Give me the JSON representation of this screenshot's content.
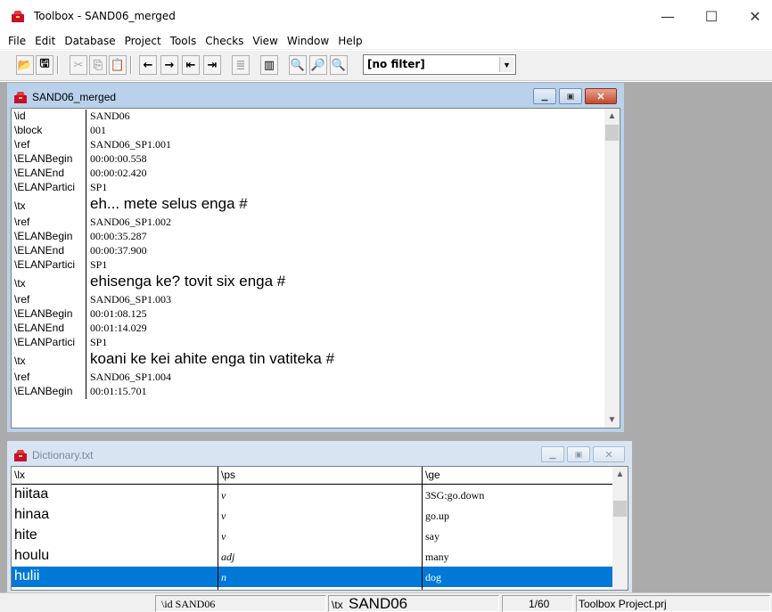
{
  "app": {
    "title": "Toolbox - SAND06_merged",
    "min_glyph": "—",
    "max_glyph": "☐",
    "close_glyph": "✕"
  },
  "menu": [
    "File",
    "Edit",
    "Database",
    "Project",
    "Tools",
    "Checks",
    "View",
    "Window",
    "Help"
  ],
  "toolbar": {
    "buttons": [
      {
        "icon": "open-folder-icon",
        "glyph": "📂"
      },
      {
        "icon": "save-icon",
        "glyph": "🖫"
      },
      {
        "icon": "cut-icon",
        "glyph": "✂"
      },
      {
        "icon": "copy-icon",
        "glyph": "⎘"
      },
      {
        "icon": "paste-icon",
        "glyph": "📋"
      },
      {
        "icon": "arrow-left-icon",
        "glyph": "←"
      },
      {
        "icon": "arrow-right-icon",
        "glyph": "→"
      },
      {
        "icon": "first-record-icon",
        "glyph": "⇤"
      },
      {
        "icon": "last-record-icon",
        "glyph": "⇥"
      },
      {
        "icon": "interlinear-icon",
        "glyph": "≣"
      },
      {
        "icon": "browse-icon",
        "glyph": "▥"
      },
      {
        "icon": "find-icon",
        "glyph": "🔍"
      },
      {
        "icon": "find-next-icon",
        "glyph": "🔎"
      },
      {
        "icon": "find-prev-icon",
        "glyph": "🔍"
      }
    ],
    "filter_value": "[no filter]"
  },
  "record_window": {
    "title": "SAND06_merged",
    "rows": [
      {
        "marker": "\\id",
        "value": "SAND06"
      },
      {
        "marker": "\\block",
        "value": "001"
      },
      {
        "marker": "\\ref",
        "value": "SAND06_SP1.001"
      },
      {
        "marker": "\\ELANBegin",
        "value": "00:00:00.558"
      },
      {
        "marker": "\\ELANEnd",
        "value": "00:00:02.420"
      },
      {
        "marker": "\\ELANPartici",
        "value": "SP1"
      },
      {
        "marker": "\\tx",
        "value": "eh... mete selus enga #",
        "big": true
      },
      {
        "marker": "\\ref",
        "value": "SAND06_SP1.002"
      },
      {
        "marker": "\\ELANBegin",
        "value": "00:00:35.287"
      },
      {
        "marker": "\\ELANEnd",
        "value": "00:00:37.900"
      },
      {
        "marker": "\\ELANPartici",
        "value": "SP1"
      },
      {
        "marker": "\\tx",
        "value": "ehisenga ke? tovit six enga #",
        "big": true
      },
      {
        "marker": "\\ref",
        "value": "SAND06_SP1.003"
      },
      {
        "marker": "\\ELANBegin",
        "value": "00:01:08.125"
      },
      {
        "marker": "\\ELANEnd",
        "value": "00:01:14.029"
      },
      {
        "marker": "\\ELANPartici",
        "value": "SP1"
      },
      {
        "marker": "\\tx",
        "value": "koani ke kei ahite enga tin vatiteka #",
        "big": true
      },
      {
        "marker": "\\ref",
        "value": "SAND06_SP1.004"
      },
      {
        "marker": "\\ELANBegin",
        "value": "00:01:15.701"
      }
    ]
  },
  "dictionary_window": {
    "title": "Dictionary.txt",
    "headers": [
      "\\lx",
      "\\ps",
      "\\ge"
    ],
    "rows": [
      {
        "lx": "hiitaa",
        "ps": "v",
        "ge": "3SG:go.down"
      },
      {
        "lx": "hinaa",
        "ps": "v",
        "ge": "go.up"
      },
      {
        "lx": "hite",
        "ps": "v",
        "ge": "say"
      },
      {
        "lx": "houlu",
        "ps": "adj",
        "ge": "many"
      },
      {
        "lx": "hulii",
        "ps": "n",
        "ge": "dog",
        "selected": true
      }
    ]
  },
  "statusbar": {
    "record_id": "\\id  SAND06",
    "tx_marker": "\\tx",
    "tx_value": "SAND06",
    "position": "1/60",
    "project": "Toolbox Project.prj"
  }
}
